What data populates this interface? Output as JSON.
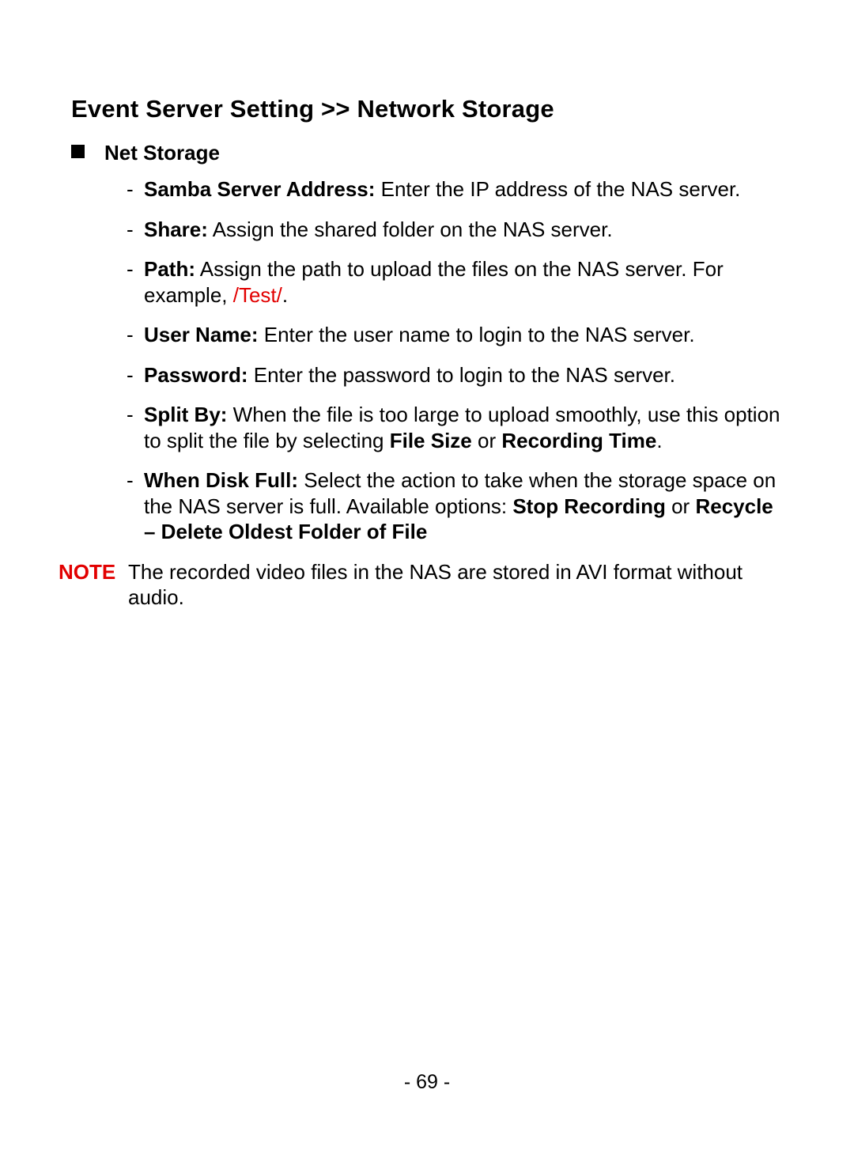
{
  "title": "Event Server Setting >> Network Storage",
  "section": {
    "title": "Net Storage",
    "items": [
      {
        "label": "Samba Server Address:",
        "text_after": " Enter the IP address of the NAS server."
      },
      {
        "label": "Share:",
        "text_after": " Assign the shared folder on the NAS server."
      },
      {
        "label": "Path:",
        "text_after": " Assign the path to upload the files on the NAS server. For example, ",
        "red_text": "/Test/",
        "tail": "."
      },
      {
        "label": "User Name:",
        "text_after": " Enter the user name to login to the NAS server."
      },
      {
        "label": "Password:",
        "text_after": " Enter the password to login to the NAS server."
      },
      {
        "label": "Split By:",
        "text_after": " When the file is too large to upload smoothly, use this option to split the file by selecting ",
        "bold_inline_1": "File Size",
        "mid_text": " or ",
        "bold_inline_2": "Recording Time",
        "tail": "."
      },
      {
        "label": "When Disk Full:",
        "text_after": " Select the action to take when the storage space on the NAS server is full. Available options: ",
        "bold_inline_1": "Stop Recording",
        "mid_text": " or ",
        "bold_inline_2": "Recycle – Delete Oldest Folder of File"
      }
    ]
  },
  "note": {
    "label": "NOTE",
    "text": "The recorded video files in the NAS are stored in AVI format without audio."
  },
  "page_number": "- 69 -",
  "dash": "-"
}
